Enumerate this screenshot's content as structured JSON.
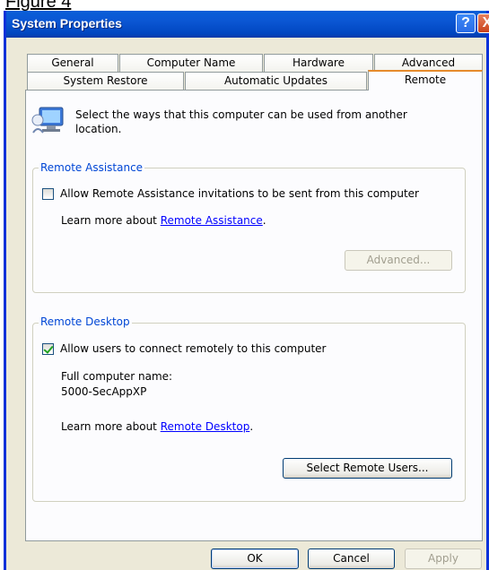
{
  "caption": "Figure 4",
  "window": {
    "title": "System Properties",
    "help_glyph": "?",
    "close_glyph": "X"
  },
  "tabs_row1": [
    "General",
    "Computer Name",
    "Hardware",
    "Advanced"
  ],
  "tabs_row2": [
    "System Restore",
    "Automatic Updates",
    "Remote"
  ],
  "active_tab": "Remote",
  "intro": "Select the ways that this computer can be used from another location.",
  "remote_assistance": {
    "legend": "Remote Assistance",
    "checkbox_label": "Allow Remote Assistance invitations to be sent from this computer",
    "checked": false,
    "learn_prefix": "Learn more about ",
    "learn_link": "Remote Assistance",
    "learn_suffix": ".",
    "advanced_button": "Advanced..."
  },
  "remote_desktop": {
    "legend": "Remote Desktop",
    "checkbox_label": "Allow users to connect remotely to this computer",
    "checked": true,
    "full_name_label": "Full computer name:",
    "full_name_value": "5000-SecAppXP",
    "learn_prefix": "Learn more about ",
    "learn_link": "Remote Desktop",
    "learn_suffix": ".",
    "select_users_button": "Select Remote Users..."
  },
  "footer": {
    "ok": "OK",
    "cancel": "Cancel",
    "apply": "Apply"
  }
}
